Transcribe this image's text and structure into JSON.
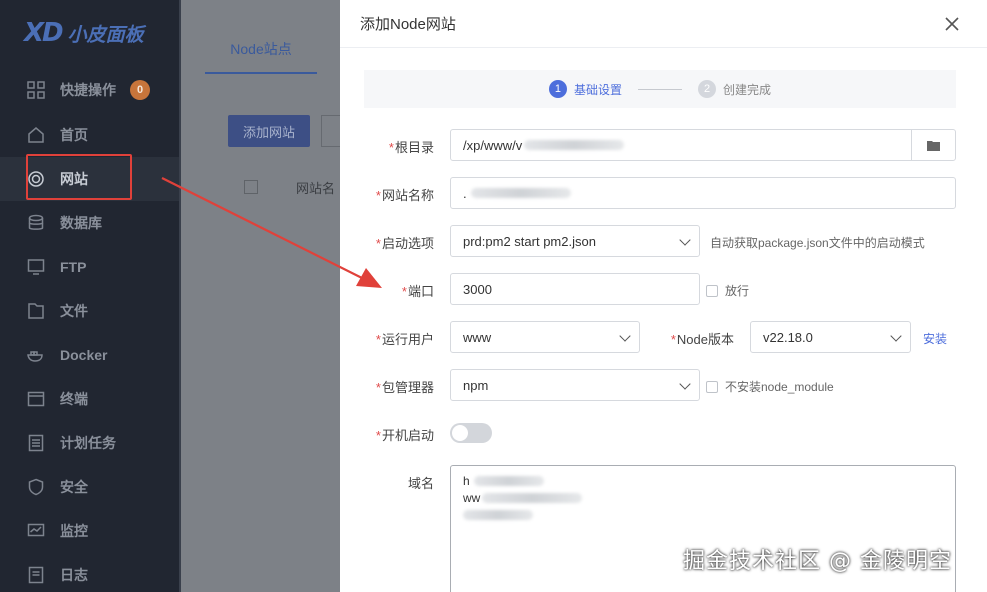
{
  "sidebar": {
    "logo_mark": "XD",
    "logo_text": "小皮面板",
    "items": [
      {
        "label": "快捷操作",
        "icon": "grid-icon",
        "badge": "0"
      },
      {
        "label": "首页",
        "icon": "home-icon"
      },
      {
        "label": "网站",
        "icon": "globe-icon"
      },
      {
        "label": "数据库",
        "icon": "database-icon"
      },
      {
        "label": "FTP",
        "icon": "ftp-icon"
      },
      {
        "label": "文件",
        "icon": "folder-icon"
      },
      {
        "label": "Docker",
        "icon": "docker-icon"
      },
      {
        "label": "终端",
        "icon": "terminal-icon"
      },
      {
        "label": "计划任务",
        "icon": "calendar-icon"
      },
      {
        "label": "安全",
        "icon": "shield-icon"
      },
      {
        "label": "监控",
        "icon": "monitor-icon"
      },
      {
        "label": "日志",
        "icon": "log-icon"
      }
    ]
  },
  "background": {
    "tab_label": "Node站点",
    "add_button": "添加网站",
    "column_site_name": "网站名"
  },
  "modal": {
    "title": "添加Node网站",
    "steps": [
      {
        "num": "1",
        "label": "基础设置"
      },
      {
        "num": "2",
        "label": "创建完成"
      }
    ],
    "root_dir": {
      "label": "根目录",
      "value": "/xp/www/v"
    },
    "site_name": {
      "label": "网站名称",
      "value": "."
    },
    "start_option": {
      "label": "启动选项",
      "value": "prd:pm2 start pm2.json",
      "hint": "自动获取package.json文件中的启动模式"
    },
    "port": {
      "label": "端口",
      "value": "3000",
      "checkbox": "放行"
    },
    "run_user": {
      "label": "运行用户",
      "value": "www"
    },
    "node_version": {
      "label": "Node版本",
      "value": "v22.18.0",
      "link": "安装"
    },
    "package_manager": {
      "label": "包管理器",
      "value": "npm",
      "checkbox": "不安装node_module"
    },
    "autostart": {
      "label": "开机启动"
    },
    "domain": {
      "label": "域名",
      "lines": [
        "h",
        "ww",
        ""
      ]
    }
  },
  "watermark": "掘金技术社区 @ 金陵明空",
  "colors": {
    "accent": "#4d6edc",
    "required": "#e04b4b",
    "highlight": "#e0413a"
  }
}
